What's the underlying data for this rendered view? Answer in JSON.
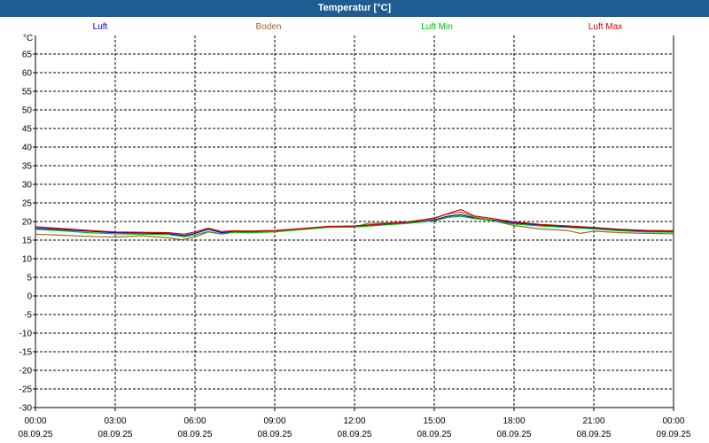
{
  "window": {
    "title": "Temperatur [°C]"
  },
  "chart_data": {
    "type": "line",
    "title": "Temperatur [°C]",
    "ylabel": "°C",
    "ylim": [
      -30,
      70
    ],
    "yticks": [
      65,
      60,
      55,
      50,
      45,
      40,
      35,
      30,
      25,
      20,
      15,
      10,
      5,
      0,
      -5,
      -10,
      -15,
      -20,
      -25,
      -30
    ],
    "xlim": [
      0,
      24
    ],
    "xticks": [
      {
        "x": 0,
        "time": "00:00",
        "date": "08.09.25"
      },
      {
        "x": 3,
        "time": "03:00",
        "date": "08.09.25"
      },
      {
        "x": 6,
        "time": "06:00",
        "date": "08.09.25"
      },
      {
        "x": 9,
        "time": "09:00",
        "date": "08.09.25"
      },
      {
        "x": 12,
        "time": "12:00",
        "date": "08.09.25"
      },
      {
        "x": 15,
        "time": "15:00",
        "date": "08.09.25"
      },
      {
        "x": 18,
        "time": "18:00",
        "date": "08.09.25"
      },
      {
        "x": 21,
        "time": "21:00",
        "date": "08.09.25"
      },
      {
        "x": 24,
        "time": "00:00",
        "date": "09.09.25"
      }
    ],
    "grid": true,
    "legend_position": "top",
    "series": [
      {
        "name": "Luft",
        "color": "#0000cc",
        "points": [
          [
            0,
            18.2
          ],
          [
            1,
            17.8
          ],
          [
            2,
            17.4
          ],
          [
            3,
            17.0
          ],
          [
            4,
            16.9
          ],
          [
            5,
            16.7
          ],
          [
            5.6,
            16.2
          ],
          [
            6,
            16.8
          ],
          [
            6.5,
            17.9
          ],
          [
            7,
            17.0
          ],
          [
            7.5,
            17.3
          ],
          [
            8,
            17.2
          ],
          [
            9,
            17.4
          ],
          [
            10,
            17.9
          ],
          [
            11,
            18.5
          ],
          [
            12,
            18.6
          ],
          [
            13,
            19.1
          ],
          [
            14,
            19.6
          ],
          [
            15,
            20.4
          ],
          [
            15.5,
            21.4
          ],
          [
            16,
            21.8
          ],
          [
            16.5,
            21.0
          ],
          [
            17,
            20.6
          ],
          [
            18,
            19.6
          ],
          [
            19,
            19.0
          ],
          [
            20,
            18.6
          ],
          [
            21,
            18.2
          ],
          [
            22,
            17.7
          ],
          [
            23,
            17.4
          ],
          [
            24,
            17.3
          ]
        ]
      },
      {
        "name": "Boden",
        "color": "#996633",
        "points": [
          [
            0,
            16.6
          ],
          [
            1,
            16.3
          ],
          [
            2,
            16.0
          ],
          [
            3,
            15.8
          ],
          [
            4,
            16.2
          ],
          [
            5,
            15.6
          ],
          [
            5.5,
            15.1
          ],
          [
            6,
            15.8
          ],
          [
            6.5,
            17.2
          ],
          [
            7,
            16.6
          ],
          [
            7.5,
            17.2
          ],
          [
            8,
            17.0
          ],
          [
            9,
            17.4
          ],
          [
            10,
            17.9
          ],
          [
            11,
            18.5
          ],
          [
            12,
            18.5
          ],
          [
            12.5,
            19.5
          ],
          [
            13,
            19.6
          ],
          [
            14,
            19.8
          ],
          [
            15,
            21.0
          ],
          [
            15.5,
            22.0
          ],
          [
            16,
            22.5
          ],
          [
            16.5,
            21.2
          ],
          [
            17,
            20.6
          ],
          [
            18,
            18.9
          ],
          [
            19,
            18.0
          ],
          [
            20,
            17.6
          ],
          [
            20.5,
            16.8
          ],
          [
            21,
            17.4
          ],
          [
            22,
            17.0
          ],
          [
            23,
            16.8
          ],
          [
            24,
            16.7
          ]
        ]
      },
      {
        "name": "Luft Min",
        "color": "#00bb00",
        "points": [
          [
            0,
            17.9
          ],
          [
            1,
            17.5
          ],
          [
            2,
            17.0
          ],
          [
            3,
            16.7
          ],
          [
            4,
            16.6
          ],
          [
            5,
            16.5
          ],
          [
            5.6,
            15.9
          ],
          [
            6,
            16.4
          ],
          [
            6.5,
            17.3
          ],
          [
            7,
            16.7
          ],
          [
            7.5,
            17.1
          ],
          [
            8,
            17.0
          ],
          [
            9,
            17.2
          ],
          [
            10,
            17.8
          ],
          [
            11,
            18.4
          ],
          [
            12,
            18.5
          ],
          [
            13,
            19.0
          ],
          [
            14,
            19.5
          ],
          [
            15,
            20.2
          ],
          [
            15.5,
            21.1
          ],
          [
            16,
            21.4
          ],
          [
            16.5,
            20.8
          ],
          [
            17,
            20.4
          ],
          [
            18,
            19.3
          ],
          [
            19,
            18.8
          ],
          [
            20,
            18.4
          ],
          [
            21,
            18.0
          ],
          [
            22,
            17.5
          ],
          [
            23,
            17.2
          ],
          [
            24,
            17.1
          ]
        ]
      },
      {
        "name": "Luft Max",
        "color": "#cc0000",
        "points": [
          [
            0,
            18.6
          ],
          [
            1,
            18.1
          ],
          [
            2,
            17.6
          ],
          [
            3,
            17.2
          ],
          [
            4,
            17.1
          ],
          [
            5,
            17.0
          ],
          [
            5.6,
            16.6
          ],
          [
            6,
            17.2
          ],
          [
            6.5,
            18.2
          ],
          [
            7,
            17.3
          ],
          [
            7.5,
            17.5
          ],
          [
            8,
            17.4
          ],
          [
            9,
            17.6
          ],
          [
            10,
            18.1
          ],
          [
            11,
            18.7
          ],
          [
            12,
            18.8
          ],
          [
            13,
            19.3
          ],
          [
            14,
            19.9
          ],
          [
            15,
            20.8
          ],
          [
            15.5,
            22.1
          ],
          [
            16,
            23.2
          ],
          [
            16.5,
            21.5
          ],
          [
            17,
            21.0
          ],
          [
            18,
            19.9
          ],
          [
            19,
            19.2
          ],
          [
            20,
            18.8
          ],
          [
            21,
            18.4
          ],
          [
            22,
            17.9
          ],
          [
            23,
            17.6
          ],
          [
            24,
            17.5
          ]
        ]
      }
    ]
  }
}
